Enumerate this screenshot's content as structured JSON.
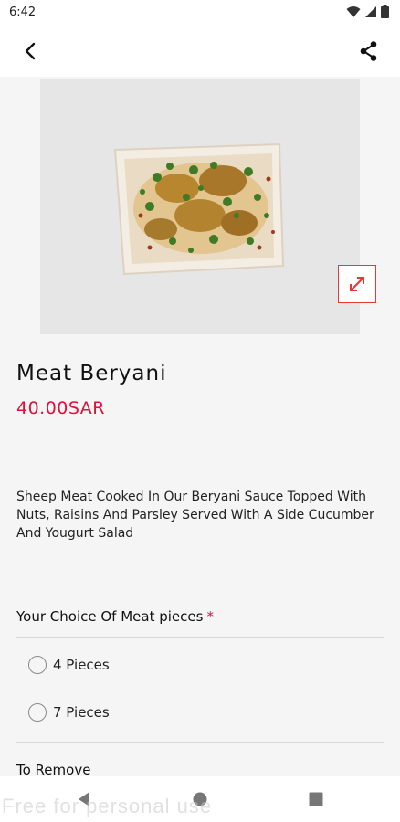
{
  "status_bar": {
    "time": "6:42"
  },
  "product": {
    "name": "Meat Beryani",
    "price": "40.00SAR",
    "description": "Sheep Meat Cooked In Our Beryani Sauce Topped With Nuts, Raisins And Parsley Served With A Side Cucumber And Yougurt Salad"
  },
  "meat_choice": {
    "title": "Your Choice Of Meat pieces",
    "required_marker": "*",
    "options": [
      {
        "label": "4 Pieces",
        "selected": false
      },
      {
        "label": "7 Pieces",
        "selected": false
      }
    ]
  },
  "to_remove": {
    "title": "To Remove"
  },
  "watermark": "Free for personal use",
  "colors": {
    "accent": "#e0103a",
    "expand_border": "#e53935",
    "image_bg": "#e6e6e6"
  }
}
